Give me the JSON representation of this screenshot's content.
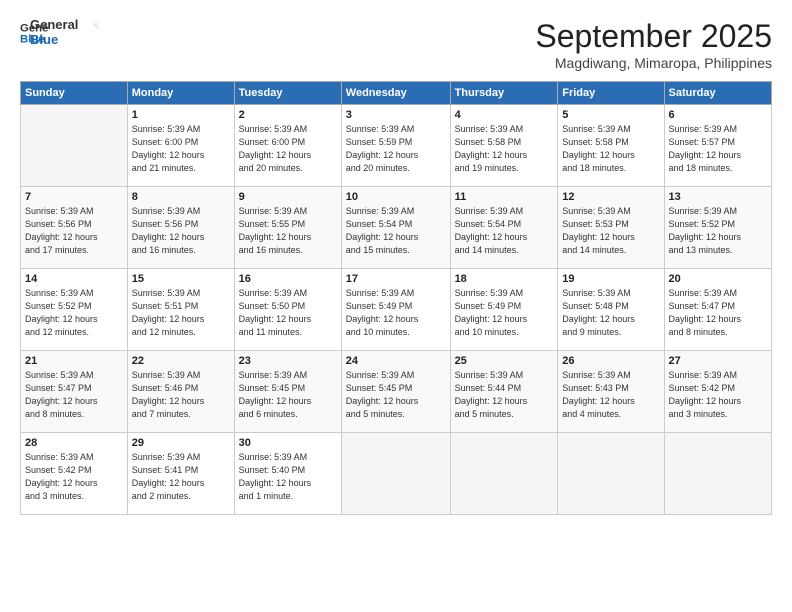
{
  "logo": {
    "line1": "General",
    "line2": "Blue"
  },
  "title": "September 2025",
  "subtitle": "Magdiwang, Mimaropa, Philippines",
  "days_of_week": [
    "Sunday",
    "Monday",
    "Tuesday",
    "Wednesday",
    "Thursday",
    "Friday",
    "Saturday"
  ],
  "weeks": [
    [
      {
        "num": "",
        "info": ""
      },
      {
        "num": "1",
        "info": "Sunrise: 5:39 AM\nSunset: 6:00 PM\nDaylight: 12 hours\nand 21 minutes."
      },
      {
        "num": "2",
        "info": "Sunrise: 5:39 AM\nSunset: 6:00 PM\nDaylight: 12 hours\nand 20 minutes."
      },
      {
        "num": "3",
        "info": "Sunrise: 5:39 AM\nSunset: 5:59 PM\nDaylight: 12 hours\nand 20 minutes."
      },
      {
        "num": "4",
        "info": "Sunrise: 5:39 AM\nSunset: 5:58 PM\nDaylight: 12 hours\nand 19 minutes."
      },
      {
        "num": "5",
        "info": "Sunrise: 5:39 AM\nSunset: 5:58 PM\nDaylight: 12 hours\nand 18 minutes."
      },
      {
        "num": "6",
        "info": "Sunrise: 5:39 AM\nSunset: 5:57 PM\nDaylight: 12 hours\nand 18 minutes."
      }
    ],
    [
      {
        "num": "7",
        "info": "Sunrise: 5:39 AM\nSunset: 5:56 PM\nDaylight: 12 hours\nand 17 minutes."
      },
      {
        "num": "8",
        "info": "Sunrise: 5:39 AM\nSunset: 5:56 PM\nDaylight: 12 hours\nand 16 minutes."
      },
      {
        "num": "9",
        "info": "Sunrise: 5:39 AM\nSunset: 5:55 PM\nDaylight: 12 hours\nand 16 minutes."
      },
      {
        "num": "10",
        "info": "Sunrise: 5:39 AM\nSunset: 5:54 PM\nDaylight: 12 hours\nand 15 minutes."
      },
      {
        "num": "11",
        "info": "Sunrise: 5:39 AM\nSunset: 5:54 PM\nDaylight: 12 hours\nand 14 minutes."
      },
      {
        "num": "12",
        "info": "Sunrise: 5:39 AM\nSunset: 5:53 PM\nDaylight: 12 hours\nand 14 minutes."
      },
      {
        "num": "13",
        "info": "Sunrise: 5:39 AM\nSunset: 5:52 PM\nDaylight: 12 hours\nand 13 minutes."
      }
    ],
    [
      {
        "num": "14",
        "info": "Sunrise: 5:39 AM\nSunset: 5:52 PM\nDaylight: 12 hours\nand 12 minutes."
      },
      {
        "num": "15",
        "info": "Sunrise: 5:39 AM\nSunset: 5:51 PM\nDaylight: 12 hours\nand 12 minutes."
      },
      {
        "num": "16",
        "info": "Sunrise: 5:39 AM\nSunset: 5:50 PM\nDaylight: 12 hours\nand 11 minutes."
      },
      {
        "num": "17",
        "info": "Sunrise: 5:39 AM\nSunset: 5:49 PM\nDaylight: 12 hours\nand 10 minutes."
      },
      {
        "num": "18",
        "info": "Sunrise: 5:39 AM\nSunset: 5:49 PM\nDaylight: 12 hours\nand 10 minutes."
      },
      {
        "num": "19",
        "info": "Sunrise: 5:39 AM\nSunset: 5:48 PM\nDaylight: 12 hours\nand 9 minutes."
      },
      {
        "num": "20",
        "info": "Sunrise: 5:39 AM\nSunset: 5:47 PM\nDaylight: 12 hours\nand 8 minutes."
      }
    ],
    [
      {
        "num": "21",
        "info": "Sunrise: 5:39 AM\nSunset: 5:47 PM\nDaylight: 12 hours\nand 8 minutes."
      },
      {
        "num": "22",
        "info": "Sunrise: 5:39 AM\nSunset: 5:46 PM\nDaylight: 12 hours\nand 7 minutes."
      },
      {
        "num": "23",
        "info": "Sunrise: 5:39 AM\nSunset: 5:45 PM\nDaylight: 12 hours\nand 6 minutes."
      },
      {
        "num": "24",
        "info": "Sunrise: 5:39 AM\nSunset: 5:45 PM\nDaylight: 12 hours\nand 5 minutes."
      },
      {
        "num": "25",
        "info": "Sunrise: 5:39 AM\nSunset: 5:44 PM\nDaylight: 12 hours\nand 5 minutes."
      },
      {
        "num": "26",
        "info": "Sunrise: 5:39 AM\nSunset: 5:43 PM\nDaylight: 12 hours\nand 4 minutes."
      },
      {
        "num": "27",
        "info": "Sunrise: 5:39 AM\nSunset: 5:42 PM\nDaylight: 12 hours\nand 3 minutes."
      }
    ],
    [
      {
        "num": "28",
        "info": "Sunrise: 5:39 AM\nSunset: 5:42 PM\nDaylight: 12 hours\nand 3 minutes."
      },
      {
        "num": "29",
        "info": "Sunrise: 5:39 AM\nSunset: 5:41 PM\nDaylight: 12 hours\nand 2 minutes."
      },
      {
        "num": "30",
        "info": "Sunrise: 5:39 AM\nSunset: 5:40 PM\nDaylight: 12 hours\nand 1 minute."
      },
      {
        "num": "",
        "info": ""
      },
      {
        "num": "",
        "info": ""
      },
      {
        "num": "",
        "info": ""
      },
      {
        "num": "",
        "info": ""
      }
    ]
  ]
}
